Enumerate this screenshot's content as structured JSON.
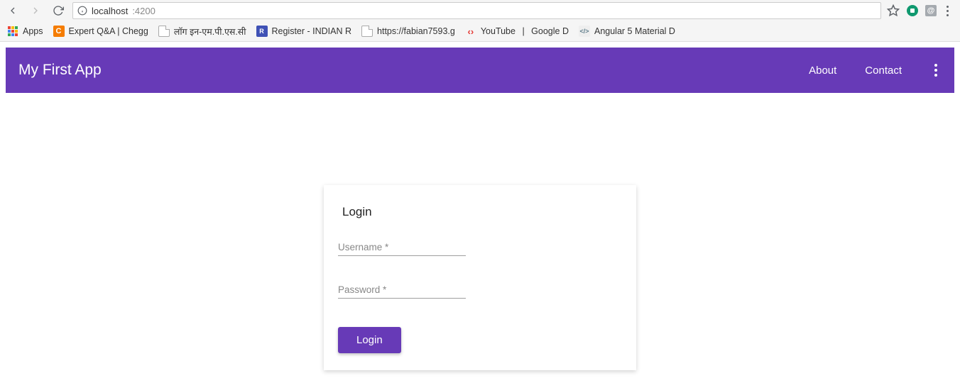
{
  "browser": {
    "url_host": "localhost",
    "url_port": ":4200",
    "bookmarks": {
      "apps": "Apps",
      "chegg": "Expert Q&A | Chegg",
      "mpsc": "लॉग इन-एम.पी.एस.सी",
      "indian": "Register - INDIAN R",
      "fabian": "https://fabian7593.g",
      "youtube": "YouTube",
      "google": "Google D",
      "angular": "Angular 5 Material D"
    }
  },
  "header": {
    "title": "My First App",
    "nav": {
      "about": "About",
      "contact": "Contact"
    }
  },
  "login": {
    "title": "Login",
    "username_label": "Username *",
    "password_label": "Password *",
    "button": "Login"
  }
}
